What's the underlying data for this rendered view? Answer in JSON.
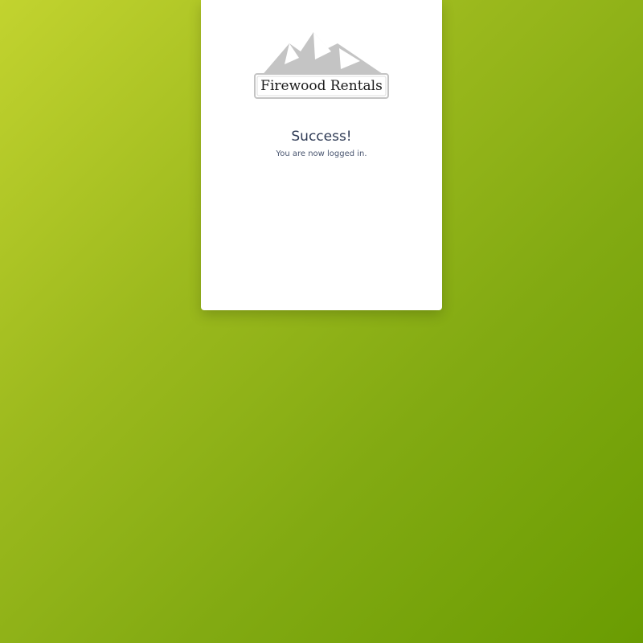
{
  "brand": {
    "logo_text": "Firewood Rentals",
    "logo_icon": "mountain-logo-icon",
    "mountain_color": "#c4c4c4"
  },
  "status": {
    "title": "Success!",
    "message": "You are now logged in."
  },
  "colors": {
    "background_start": "#c2d32f",
    "background_end": "#6a9c02",
    "card": "#ffffff",
    "text": "#2f3b55"
  }
}
